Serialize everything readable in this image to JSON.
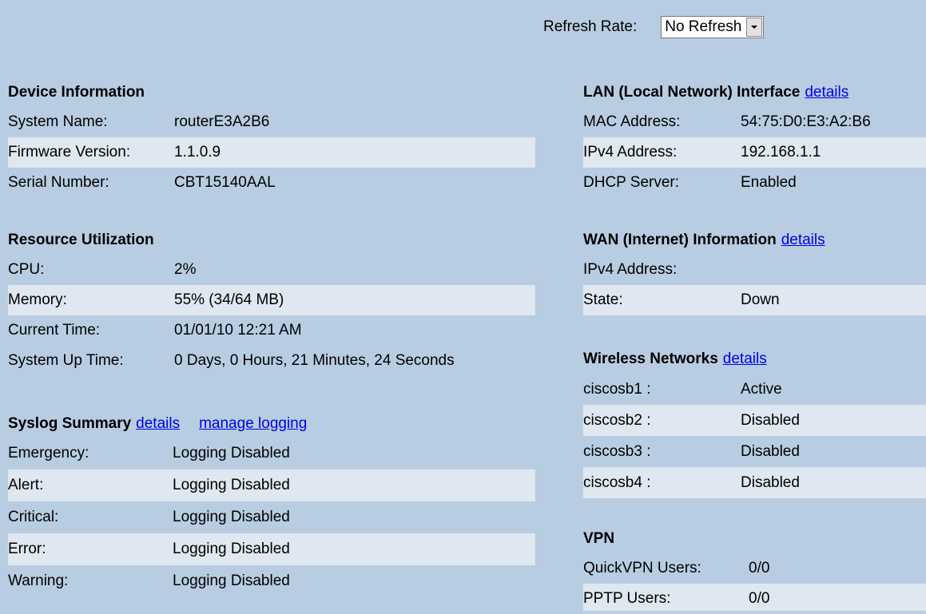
{
  "refresh": {
    "label": "Refresh Rate:",
    "value": "No Refresh"
  },
  "device_information": {
    "title": "Device Information",
    "rows": [
      {
        "label": "System Name:",
        "value": "routerE3A2B6"
      },
      {
        "label": "Firmware Version:",
        "value": "1.1.0.9"
      },
      {
        "label": "Serial Number:",
        "value": "CBT15140AAL"
      }
    ]
  },
  "resource_utilization": {
    "title": "Resource Utilization",
    "rows": [
      {
        "label": "CPU:",
        "value": "2%"
      },
      {
        "label": "Memory:",
        "value": "55% (34/64 MB)"
      },
      {
        "label": "Current Time:",
        "value": "01/01/10 12:21 AM"
      },
      {
        "label": "System Up Time:",
        "value": "0 Days, 0 Hours, 21 Minutes, 24 Seconds"
      }
    ]
  },
  "syslog_summary": {
    "title": "Syslog Summary",
    "details_link": "details",
    "manage_link": "manage logging",
    "rows": [
      {
        "label": "Emergency:",
        "value": "Logging Disabled"
      },
      {
        "label": "Alert:",
        "value": "Logging Disabled"
      },
      {
        "label": "Critical:",
        "value": "Logging Disabled"
      },
      {
        "label": "Error:",
        "value": "Logging Disabled"
      },
      {
        "label": "Warning:",
        "value": "Logging Disabled"
      }
    ]
  },
  "lan_interface": {
    "title": "LAN (Local Network) Interface",
    "details_link": "details",
    "rows": [
      {
        "label": "MAC Address:",
        "value": "54:75:D0:E3:A2:B6"
      },
      {
        "label": "IPv4 Address:",
        "value": "192.168.1.1"
      },
      {
        "label": "DHCP Server:",
        "value": "Enabled"
      }
    ]
  },
  "wan_information": {
    "title": "WAN (Internet) Information",
    "details_link": "details",
    "rows": [
      {
        "label": "IPv4 Address:",
        "value": ""
      },
      {
        "label": "State:",
        "value": "Down"
      }
    ]
  },
  "wireless_networks": {
    "title": "Wireless Networks",
    "details_link": "details",
    "rows": [
      {
        "label": "ciscosb1 :",
        "value": "Active"
      },
      {
        "label": "ciscosb2 :",
        "value": "Disabled"
      },
      {
        "label": "ciscosb3 :",
        "value": "Disabled"
      },
      {
        "label": "ciscosb4 :",
        "value": "Disabled"
      }
    ]
  },
  "vpn": {
    "title": "VPN",
    "rows": [
      {
        "label": "QuickVPN Users:",
        "value": "0/0"
      },
      {
        "label": "PPTP Users:",
        "value": "0/0"
      }
    ]
  }
}
